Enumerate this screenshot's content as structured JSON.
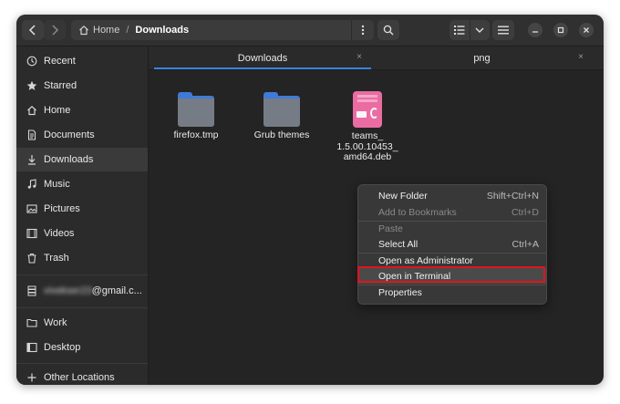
{
  "header": {
    "breadcrumbs": [
      {
        "label": "Home",
        "icon": "home-icon"
      },
      {
        "label": "Downloads"
      }
    ],
    "path_separator": "/"
  },
  "sidebar": {
    "items": [
      {
        "label": "Recent",
        "icon": "clock-icon"
      },
      {
        "label": "Starred",
        "icon": "star-icon"
      },
      {
        "label": "Home",
        "icon": "home-icon"
      },
      {
        "label": "Documents",
        "icon": "document-icon"
      },
      {
        "label": "Downloads",
        "icon": "download-icon",
        "active": true
      },
      {
        "label": "Music",
        "icon": "music-icon"
      },
      {
        "label": "Pictures",
        "icon": "picture-icon"
      },
      {
        "label": "Videos",
        "icon": "video-icon"
      },
      {
        "label": "Trash",
        "icon": "trash-icon"
      }
    ],
    "account": {
      "label_blurred": "vivekser23",
      "label_suffix": "@gmail.c...",
      "icon": "network-drive-icon"
    },
    "bookmarks": [
      {
        "label": "Work",
        "icon": "folder-icon"
      },
      {
        "label": "Desktop",
        "icon": "desktop-icon"
      }
    ],
    "other": {
      "label": "Other Locations",
      "icon": "plus-icon"
    }
  },
  "tabs": [
    {
      "label": "Downloads",
      "active": true,
      "close": "×"
    },
    {
      "label": "png",
      "active": false,
      "close": "×"
    }
  ],
  "files": [
    {
      "name": "firefox.tmp",
      "type": "folder"
    },
    {
      "name": "Grub themes",
      "type": "folder"
    },
    {
      "name_lines": [
        "teams_",
        "1.5.00.10453_",
        "amd64.deb"
      ],
      "type": "deb"
    }
  ],
  "context_menu": {
    "items": [
      {
        "label": "New Folder",
        "shortcut": "Shift+Ctrl+N",
        "enabled": true
      },
      {
        "label": "Add to Bookmarks",
        "shortcut": "Ctrl+D",
        "enabled": false
      },
      {
        "label": "Paste",
        "shortcut": "",
        "enabled": false
      },
      {
        "label": "Select All",
        "shortcut": "Ctrl+A",
        "enabled": true
      },
      {
        "label": "Open as Administrator",
        "shortcut": "",
        "enabled": true
      },
      {
        "label": "Open in Terminal",
        "shortcut": "",
        "enabled": true,
        "highlighted": true
      },
      {
        "label": "Properties",
        "shortcut": "",
        "enabled": true
      }
    ]
  },
  "colors": {
    "accent": "#3584e4",
    "highlight_box": "#e0141b",
    "folder": "#757c86",
    "deb_package": "#ea6ca3"
  }
}
